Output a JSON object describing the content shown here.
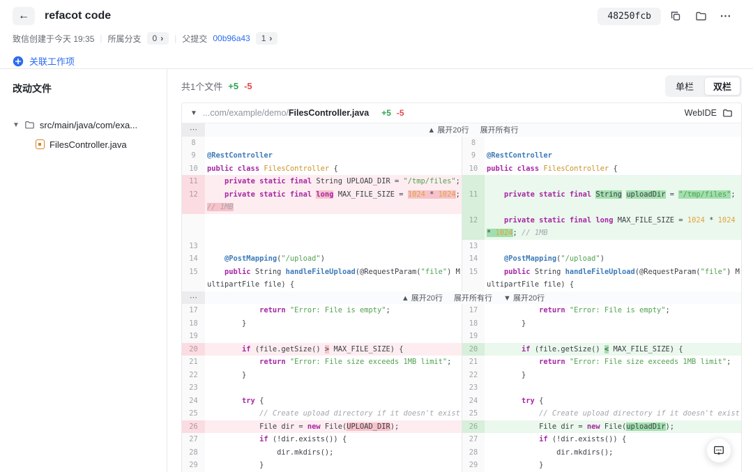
{
  "header": {
    "back": "←",
    "title": "refacot code",
    "hash": "48250fcb",
    "meta": {
      "created": "致信创建于今天 19:35",
      "branch_label": "所属分支",
      "branch_count": "0",
      "chevron": "›",
      "parent_label": "父提交",
      "parent_hash": "00b96a43",
      "parent_count": "1"
    },
    "link_work_item": "关联工作项"
  },
  "sidebar": {
    "title": "改动文件",
    "folder": "src/main/java/com/exa...",
    "file": "FilesController.java"
  },
  "toolbar": {
    "summary": "共1个文件",
    "added": "+5",
    "removed": "-5",
    "single_col": "单栏",
    "double_col": "双栏"
  },
  "file_header": {
    "path_prefix": "...com/example/demo/",
    "path_name": "FilesController.java",
    "added": "+5",
    "removed": "-5",
    "webide": "WebIDE"
  },
  "colors": {
    "added_accent": "#2da44e",
    "removed_accent": "#e5484d",
    "link_blue": "#2b6cf0",
    "removed_line_bg": "#fdedf0",
    "added_line_bg": "#ebf8ed",
    "removed_word_bg": "#f7c2ca",
    "added_word_bg": "#a2dfae"
  },
  "code": {
    "dots": "⋯",
    "rows": [
      {
        "t": "x",
        "labels": [
          "▲ 展开20行",
          "展开所有行"
        ]
      },
      {
        "ln": "8",
        "rn": "8",
        "ls": [],
        "rs": []
      },
      {
        "ln": "9",
        "rn": "9",
        "ls": [
          [
            "@RestController",
            "a"
          ]
        ],
        "rs": [
          [
            "@RestController",
            "a"
          ]
        ]
      },
      {
        "ln": "10",
        "rn": "10",
        "ls": [
          [
            "public class",
            "k"
          ],
          [
            " ",
            "p"
          ],
          [
            "FilesController",
            "t"
          ],
          [
            " {",
            "p"
          ]
        ],
        "rs": [
          [
            "public class",
            "k"
          ],
          [
            " ",
            "p"
          ],
          [
            "FilesController",
            "t"
          ],
          [
            " {",
            "p"
          ]
        ]
      },
      {
        "ln": "11",
        "lb": "d",
        "ls": [
          [
            "    ",
            "p"
          ],
          [
            "private static final",
            "k"
          ],
          [
            " String UPLOAD_DIR = ",
            "p"
          ],
          [
            "\"/tmp/files\"",
            "s"
          ],
          [
            ";",
            "p"
          ]
        ],
        "rn": "",
        "rb": "a",
        "rs": []
      },
      {
        "ln": "12",
        "lb": "d",
        "ls": [
          [
            "    ",
            "p"
          ],
          [
            "private static final",
            "k"
          ],
          [
            " ",
            "p"
          ],
          [
            "long",
            "k",
            "d"
          ],
          [
            " MAX_FILE_SIZE = ",
            "p"
          ],
          [
            "1024",
            "n",
            "d"
          ],
          [
            " * ",
            "p",
            "d"
          ],
          [
            "1024",
            "n",
            "d"
          ],
          [
            ";",
            "p"
          ]
        ],
        "rn": "11",
        "rb": "a",
        "rs": [
          [
            "    ",
            "p"
          ],
          [
            "private static final",
            "k"
          ],
          [
            " ",
            "p"
          ],
          [
            "String",
            "p",
            "g"
          ],
          [
            " ",
            "p"
          ],
          [
            "uploadDir",
            "p",
            "g"
          ],
          [
            " = ",
            "p"
          ],
          [
            "\"/tmp/files\"",
            "s",
            "g"
          ],
          [
            ";",
            "p"
          ]
        ]
      },
      {
        "ln": "",
        "lb": "d",
        "ls": [
          [
            "// 1MB",
            "c",
            "d"
          ]
        ],
        "rn": "",
        "rb": "a",
        "rs": []
      },
      {
        "ln": "",
        "ls": [],
        "rn": "12",
        "rb": "a",
        "rs": [
          [
            "    ",
            "p"
          ],
          [
            "private static final",
            "k"
          ],
          [
            " ",
            "p"
          ],
          [
            "long",
            "k"
          ],
          [
            " MAX_FILE_SIZE = ",
            "p"
          ],
          [
            "1024",
            "n"
          ],
          [
            " * ",
            "p"
          ],
          [
            "1024",
            "n"
          ]
        ]
      },
      {
        "ln": "",
        "ls": [],
        "rn": "",
        "rb": "a",
        "rs": [
          [
            "* ",
            "p",
            "g"
          ],
          [
            "1024",
            "n",
            "g"
          ],
          [
            "; ",
            "p"
          ],
          [
            "// 1MB",
            "c"
          ]
        ]
      },
      {
        "ln": "13",
        "rn": "13",
        "ls": [],
        "rs": []
      },
      {
        "ln": "14",
        "rn": "14",
        "ls": [
          [
            "    ",
            "p"
          ],
          [
            "@PostMapping",
            "a"
          ],
          [
            "(",
            "p"
          ],
          [
            "\"/upload\"",
            "s"
          ],
          [
            ")",
            "p"
          ]
        ],
        "rs": [
          [
            "    ",
            "p"
          ],
          [
            "@PostMapping",
            "a"
          ],
          [
            "(",
            "p"
          ],
          [
            "\"/upload\"",
            "s"
          ],
          [
            ")",
            "p"
          ]
        ]
      },
      {
        "ln": "15",
        "rn": "15",
        "ls": [
          [
            "    ",
            "p"
          ],
          [
            "public",
            "k"
          ],
          [
            " String ",
            "p"
          ],
          [
            "handleFileUpload",
            "a"
          ],
          [
            "(@RequestParam(",
            "p"
          ],
          [
            "\"file\"",
            "s"
          ],
          [
            ") M",
            "p"
          ]
        ],
        "rs": [
          [
            "    ",
            "p"
          ],
          [
            "public",
            "k"
          ],
          [
            " String ",
            "p"
          ],
          [
            "handleFileUpload",
            "a"
          ],
          [
            "(@RequestParam(",
            "p"
          ],
          [
            "\"file\"",
            "s"
          ],
          [
            ") M",
            "p"
          ]
        ]
      },
      {
        "ln": "",
        "rn": "",
        "ls": [
          [
            "ultipartFile file) {",
            "p"
          ]
        ],
        "rs": [
          [
            "ultipartFile file) {",
            "p"
          ]
        ]
      },
      {
        "t": "x",
        "labels": [
          "▲ 展开20行",
          "展开所有行",
          "▼ 展开20行"
        ]
      },
      {
        "ln": "17",
        "rn": "17",
        "ls": [
          [
            "            ",
            "p"
          ],
          [
            "return",
            "k"
          ],
          [
            " ",
            "p"
          ],
          [
            "\"Error: File is empty\"",
            "s"
          ],
          [
            ";",
            "p"
          ]
        ],
        "rs": [
          [
            "            ",
            "p"
          ],
          [
            "return",
            "k"
          ],
          [
            " ",
            "p"
          ],
          [
            "\"Error: File is empty\"",
            "s"
          ],
          [
            ";",
            "p"
          ]
        ]
      },
      {
        "ln": "18",
        "rn": "18",
        "ls": [
          [
            "        }",
            "p"
          ]
        ],
        "rs": [
          [
            "        }",
            "p"
          ]
        ]
      },
      {
        "ln": "19",
        "rn": "19",
        "ls": [],
        "rs": []
      },
      {
        "ln": "20",
        "lb": "d",
        "ls": [
          [
            "        ",
            "p"
          ],
          [
            "if",
            "k"
          ],
          [
            " (file.getSize() ",
            "p"
          ],
          [
            ">",
            "p",
            "d"
          ],
          [
            " MAX_FILE_SIZE) {",
            "p"
          ]
        ],
        "rn": "20",
        "rb": "a",
        "rs": [
          [
            "        ",
            "p"
          ],
          [
            "if",
            "k"
          ],
          [
            " (file.getSize() ",
            "p"
          ],
          [
            "<",
            "p",
            "g"
          ],
          [
            " MAX_FILE_SIZE) {",
            "p"
          ]
        ]
      },
      {
        "ln": "21",
        "rn": "21",
        "ls": [
          [
            "            ",
            "p"
          ],
          [
            "return",
            "k"
          ],
          [
            " ",
            "p"
          ],
          [
            "\"Error: File size exceeds 1MB limit\"",
            "s"
          ],
          [
            ";",
            "p"
          ]
        ],
        "rs": [
          [
            "            ",
            "p"
          ],
          [
            "return",
            "k"
          ],
          [
            " ",
            "p"
          ],
          [
            "\"Error: File size exceeds 1MB limit\"",
            "s"
          ],
          [
            ";",
            "p"
          ]
        ]
      },
      {
        "ln": "22",
        "rn": "22",
        "ls": [
          [
            "        }",
            "p"
          ]
        ],
        "rs": [
          [
            "        }",
            "p"
          ]
        ]
      },
      {
        "ln": "23",
        "rn": "23",
        "ls": [],
        "rs": []
      },
      {
        "ln": "24",
        "rn": "24",
        "ls": [
          [
            "        ",
            "p"
          ],
          [
            "try",
            "k"
          ],
          [
            " {",
            "p"
          ]
        ],
        "rs": [
          [
            "        ",
            "p"
          ],
          [
            "try",
            "k"
          ],
          [
            " {",
            "p"
          ]
        ]
      },
      {
        "ln": "25",
        "rn": "25",
        "ls": [
          [
            "            ",
            "p"
          ],
          [
            "// Create upload directory if it doesn't exist",
            "c"
          ]
        ],
        "rs": [
          [
            "            ",
            "p"
          ],
          [
            "// Create upload directory if it doesn't exist",
            "c"
          ]
        ]
      },
      {
        "ln": "26",
        "lb": "d",
        "ls": [
          [
            "            File dir = ",
            "p"
          ],
          [
            "new",
            "k"
          ],
          [
            " File(",
            "p"
          ],
          [
            "UPLOAD_DIR",
            "p",
            "d"
          ],
          [
            ");",
            "p"
          ]
        ],
        "rn": "26",
        "rb": "a",
        "rs": [
          [
            "            File dir = ",
            "p"
          ],
          [
            "new",
            "k"
          ],
          [
            " File(",
            "p"
          ],
          [
            "uploadDir",
            "p",
            "g"
          ],
          [
            ");",
            "p"
          ]
        ]
      },
      {
        "ln": "27",
        "rn": "27",
        "ls": [
          [
            "            ",
            "p"
          ],
          [
            "if",
            "k"
          ],
          [
            " (!dir.exists()) {",
            "p"
          ]
        ],
        "rs": [
          [
            "            ",
            "p"
          ],
          [
            "if",
            "k"
          ],
          [
            " (!dir.exists()) {",
            "p"
          ]
        ]
      },
      {
        "ln": "28",
        "rn": "28",
        "ls": [
          [
            "                dir.mkdirs();",
            "p"
          ]
        ],
        "rs": [
          [
            "                dir.mkdirs();",
            "p"
          ]
        ]
      },
      {
        "ln": "29",
        "rn": "29",
        "ls": [
          [
            "            }",
            "p"
          ]
        ],
        "rs": [
          [
            "            }",
            "p"
          ]
        ]
      }
    ]
  }
}
